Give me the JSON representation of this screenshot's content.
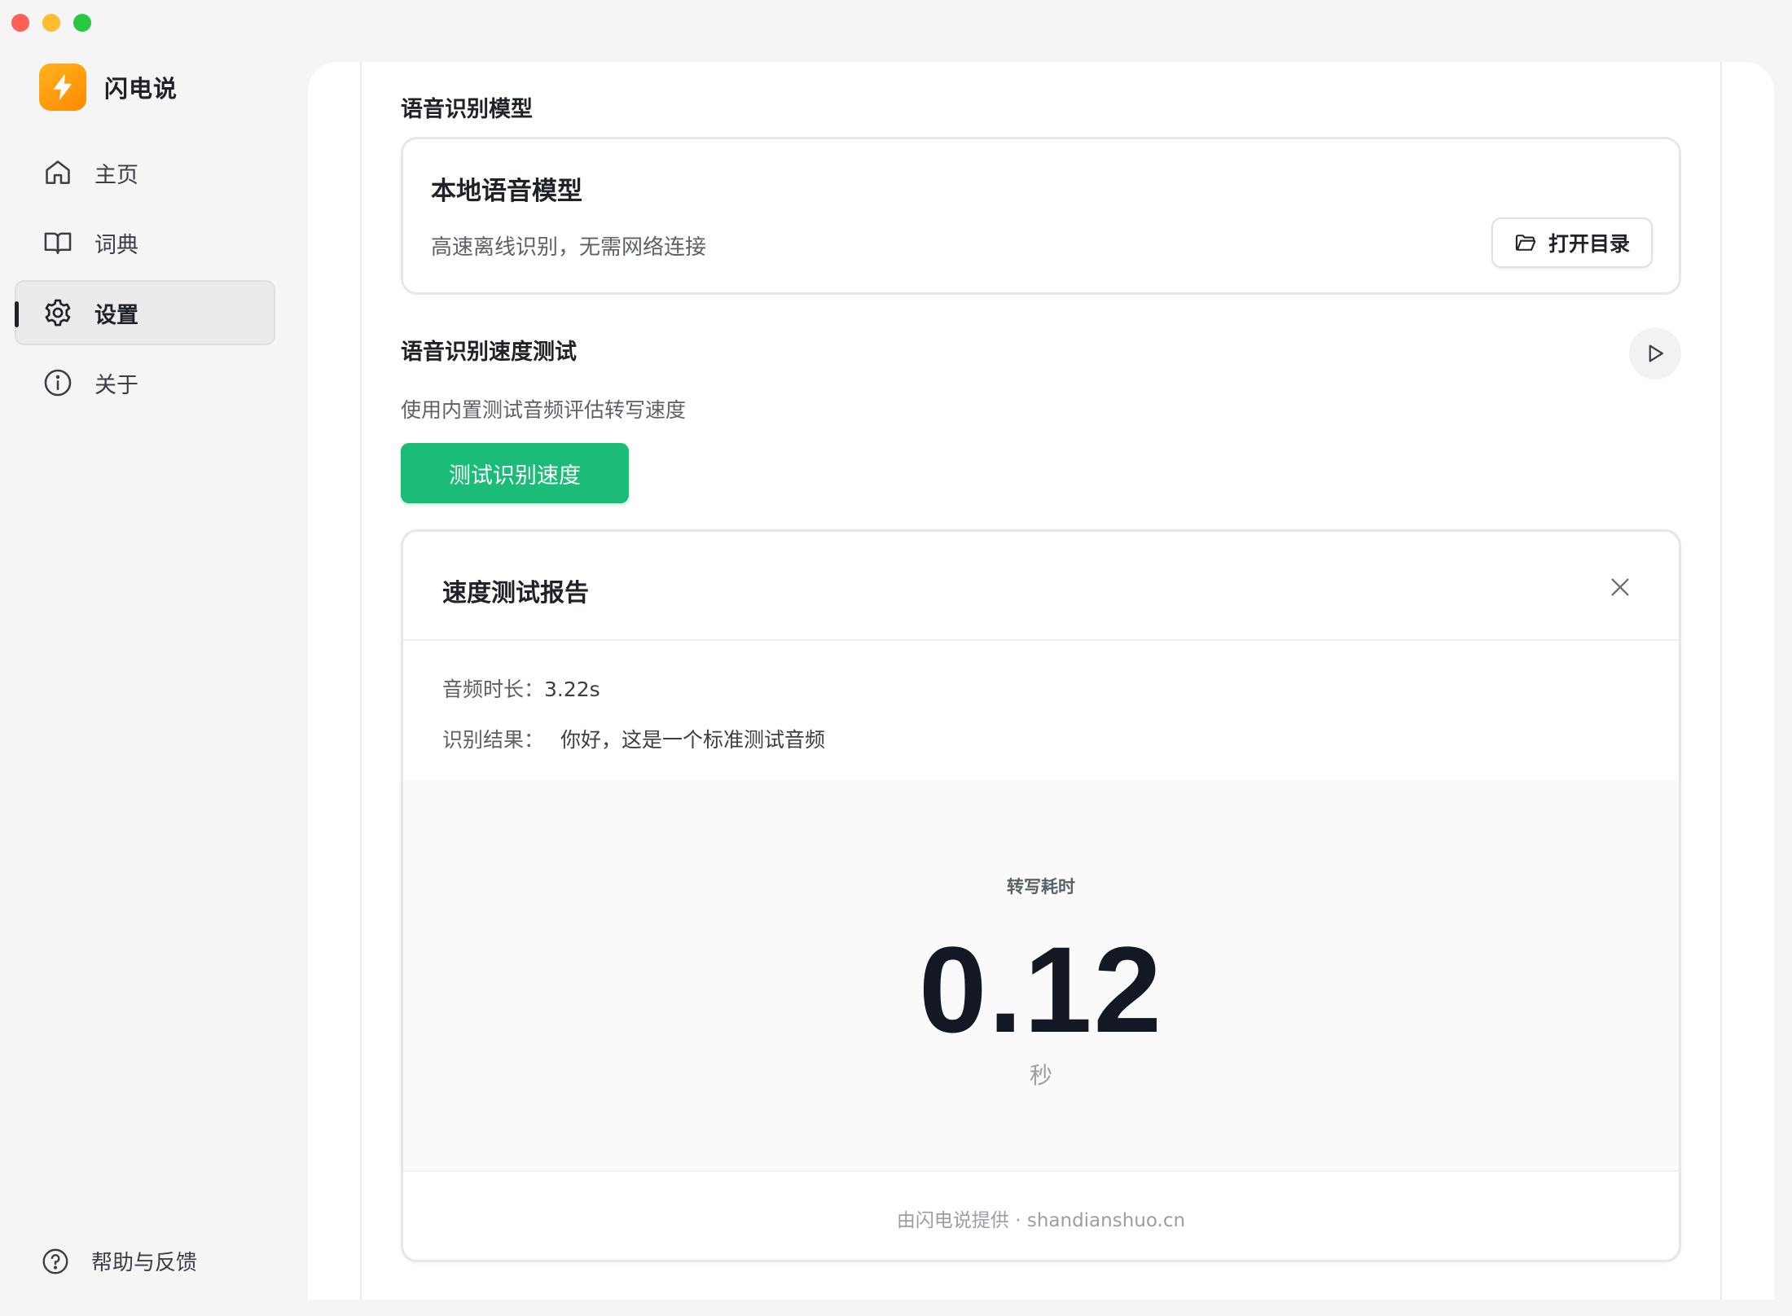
{
  "app": {
    "name": "闪电说"
  },
  "sidebar": {
    "items": [
      {
        "label": "主页",
        "icon": "home-icon"
      },
      {
        "label": "词典",
        "icon": "book-icon"
      },
      {
        "label": "设置",
        "icon": "gear-icon",
        "active": true
      },
      {
        "label": "关于",
        "icon": "info-icon"
      }
    ],
    "help_label": "帮助与反馈"
  },
  "model_section": {
    "title": "语音识别模型",
    "card": {
      "name": "本地语音模型",
      "description": "高速离线识别，无需网络连接",
      "open_dir_label": "打开目录"
    }
  },
  "speed_section": {
    "title": "语音识别速度测试",
    "description": "使用内置测试音频评估转写速度",
    "test_button_label": "测试识别速度"
  },
  "report": {
    "title": "速度测试报告",
    "duration_label": "音频时长：",
    "duration_value": "3.22s",
    "result_label": "识别结果：",
    "result_value": "你好，这是一个标准测试音频",
    "metric_label": "转写耗时",
    "metric_value": "0.12",
    "metric_unit": "秒",
    "credit": "由闪电说提供 · shandianshuo.cn"
  },
  "colors": {
    "accent_green": "#1bbb78",
    "brand_orange": "#ff9a0a"
  }
}
